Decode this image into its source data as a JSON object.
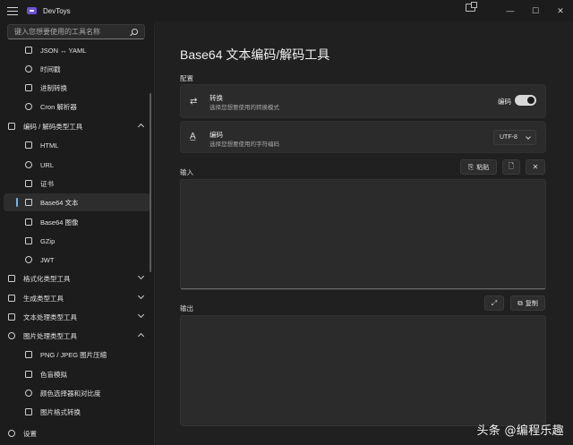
{
  "window": {
    "title": "DevToys"
  },
  "sidebar": {
    "search_placeholder": "键入您想要使用的工具名称",
    "items": [
      {
        "label": "JSON ↔ YAML",
        "top": 0
      },
      {
        "label": "时间戳"
      },
      {
        "label": "进制转换"
      },
      {
        "label": "Cron 解析器"
      },
      {
        "label": "编码 / 解码类型工具"
      },
      {
        "label": "HTML"
      },
      {
        "label": "URL"
      },
      {
        "label": "证书"
      },
      {
        "label": "Base64 文本"
      },
      {
        "label": "Base64 图像"
      },
      {
        "label": "GZip"
      },
      {
        "label": "JWT"
      },
      {
        "label": "格式化类型工具"
      },
      {
        "label": "生成类型工具"
      },
      {
        "label": "文本处理类型工具"
      },
      {
        "label": "图片处理类型工具"
      },
      {
        "label": "PNG / JPEG 图片压缩"
      },
      {
        "label": "色盲模拟"
      },
      {
        "label": "颜色选择器和对比度"
      },
      {
        "label": "图片格式转换"
      },
      {
        "label": "设置"
      }
    ]
  },
  "main": {
    "title": "Base64 文本编码/解码工具",
    "config_label": "配置",
    "conversion": {
      "title": "转换",
      "desc": "选择您想要使用的转换模式",
      "value": "编码",
      "icon": "swap-icon"
    },
    "encoding": {
      "title": "编码",
      "desc": "选择您想要使用的字符编码",
      "value": "UTF-8",
      "icon": "font-icon"
    },
    "input": {
      "label": "输入",
      "paste_label": "粘贴"
    },
    "output": {
      "label": "输出",
      "copy_label": "复制"
    }
  },
  "watermark": "头条 @编程乐趣"
}
